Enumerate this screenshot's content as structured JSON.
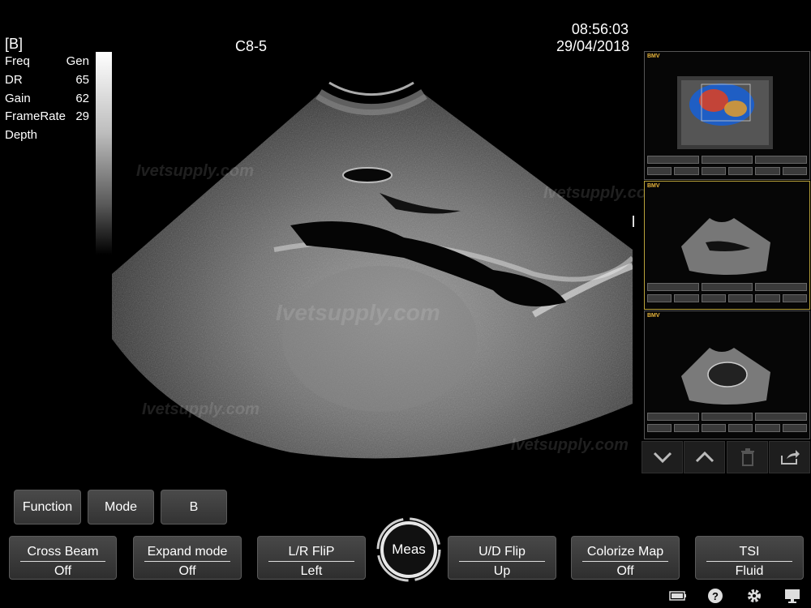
{
  "header": {
    "mode_tag": "[B]",
    "probe": "C8-5",
    "time": "08:56:03",
    "date": "29/04/2018"
  },
  "params": [
    {
      "label": "Freq",
      "value": "Gen"
    },
    {
      "label": "DR",
      "value": "65"
    },
    {
      "label": "Gain",
      "value": "62"
    },
    {
      "label": "FrameRate",
      "value": "29"
    },
    {
      "label": "Depth",
      "value": ""
    }
  ],
  "watermark": {
    "text1": "Ivetsupply.com",
    "text2": "Ivetsupply.com",
    "text3": "Ivetsupply.com",
    "text4": "Ivetsupply.com",
    "text5": "Ivetsupply.com"
  },
  "thumbnails": [
    {
      "logo": "BMV",
      "kind": "color-doppler"
    },
    {
      "logo": "BMV",
      "kind": "b-mode",
      "active": true
    },
    {
      "logo": "BMV",
      "kind": "b-mode"
    }
  ],
  "thumb_controls": [
    {
      "icon": "chevron-down-icon"
    },
    {
      "icon": "chevron-up-icon"
    },
    {
      "icon": "trash-icon"
    },
    {
      "icon": "export-icon"
    }
  ],
  "top_buttons": {
    "function": "Function",
    "mode": "Mode",
    "b": "B"
  },
  "toggles": {
    "cross_beam": {
      "label": "Cross Beam",
      "value": "Off"
    },
    "expand_mode": {
      "label": "Expand mode",
      "value": "Off"
    },
    "lr_flip": {
      "label": "L/R FliP",
      "value": "Left"
    },
    "ud_flip": {
      "label": "U/D Flip",
      "value": "Up"
    },
    "colorize_map": {
      "label": "Colorize Map",
      "value": "Off"
    },
    "tsi": {
      "label": "TSI",
      "value": "Fluid"
    }
  },
  "meas": "Meas",
  "status_icons": [
    "battery-icon",
    "help-icon",
    "settings-icon",
    "monitor-icon"
  ]
}
